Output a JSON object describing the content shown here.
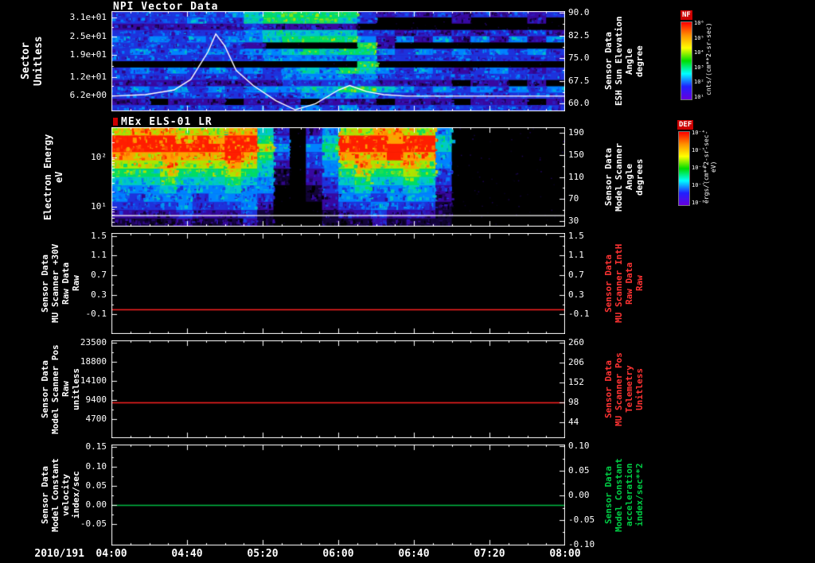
{
  "x_axis": {
    "date_label": "2010/191",
    "tick_labels": [
      "04:00",
      "04:40",
      "05:20",
      "06:00",
      "06:40",
      "07:20",
      "08:00"
    ],
    "range_hours": [
      4,
      8
    ]
  },
  "colorbars": [
    {
      "name": "NF",
      "units": "cnts/(cm**2-sr-sec)",
      "tick_labels": [
        "10⁶",
        "10⁵",
        "10⁴",
        "10³",
        "10²",
        "10¹"
      ],
      "gradient_top_to_bottom": [
        "#ff0000",
        "#ff9000",
        "#ffff00",
        "#00dd00",
        "#00ffff",
        "#2020ff",
        "#6600dd"
      ]
    },
    {
      "name": "DEF",
      "units": "ergs/(cm**2-sr-sec-eV)",
      "tick_labels": [
        "10⁻⁴",
        "10⁻⁵",
        "10⁻⁶",
        "10⁻⁷",
        "10⁻⁸"
      ],
      "gradient_top_to_bottom": [
        "#ff0000",
        "#ff9000",
        "#ffff00",
        "#00dd00",
        "#00ffff",
        "#2020ff",
        "#6600dd"
      ]
    }
  ],
  "chart_data": [
    {
      "type": "heatmap",
      "title": "NPI Vector Data",
      "left_label_lines": [
        "Sector",
        "Unitless"
      ],
      "right_label_lines": [
        "Sensor Data",
        "ESH Sun Elevation",
        "Angle",
        "degree"
      ],
      "right_label_color": "#ffffff",
      "left_axis": {
        "range": [
          1,
          33
        ],
        "ticks": [
          {
            "label": "3.1e+01",
            "value": 31
          },
          {
            "label": "2.5e+01",
            "value": 25
          },
          {
            "label": "1.9e+01",
            "value": 19
          },
          {
            "label": "1.2e+01",
            "value": 12
          },
          {
            "label": "6.2e+00",
            "value": 6.2
          }
        ]
      },
      "right_axis": {
        "range": [
          57.5,
          90.5
        ],
        "ticks": [
          {
            "label": "90.0",
            "value": 90
          },
          {
            "label": "82.5",
            "value": 82.5
          },
          {
            "label": "75.0",
            "value": 75
          },
          {
            "label": "67.5",
            "value": 67.5
          },
          {
            "label": "60.0",
            "value": 60
          }
        ]
      },
      "grid": [
        "333333456666632323232323",
        "333343356666530000200020",
        "222222232222200000000000",
        "333333345555533232323232",
        "434343445666642424242424",
        "333333320000062000000000",
        "343434344565664343434343",
        "333333334444443333333333",
        "000000000000060000000000",
        "343434343454654343234323",
        "333333333444443333333333",
        "222222222333332222022020",
        "343434344455665434343434",
        "333333333344443333333333",
        "220222022202220222022202",
        "333333333343433333333333"
      ],
      "overlay": {
        "kind": "polyline",
        "axis": "right",
        "color": "#ffffff",
        "points": [
          [
            4.0,
            62.5
          ],
          [
            4.3,
            63
          ],
          [
            4.55,
            64.5
          ],
          [
            4.7,
            68
          ],
          [
            4.85,
            77
          ],
          [
            4.92,
            83
          ],
          [
            5.0,
            79
          ],
          [
            5.1,
            71
          ],
          [
            5.25,
            66
          ],
          [
            5.45,
            61
          ],
          [
            5.62,
            58
          ],
          [
            5.8,
            60
          ],
          [
            6.0,
            64.5
          ],
          [
            6.1,
            66
          ],
          [
            6.25,
            64
          ],
          [
            6.4,
            63
          ],
          [
            6.6,
            62.5
          ],
          [
            8.0,
            62.5
          ]
        ]
      }
    },
    {
      "type": "heatmap",
      "title": "MEx ELS-01 LR",
      "left_label_lines": [
        "Electron Energy",
        "eV"
      ],
      "right_label_lines": [
        "Sensor Data",
        "Model Scanner",
        "Angle",
        "degrees"
      ],
      "right_label_color": "#ffffff",
      "left_axis": {
        "scale": "log",
        "range": [
          4,
          400
        ],
        "ticks": [
          {
            "label": "10²",
            "value": 100
          },
          {
            "label": "10¹",
            "value": 10
          }
        ],
        "minor_values": [
          300,
          200,
          90,
          80,
          70,
          60,
          50,
          40,
          30,
          20,
          9,
          8,
          7,
          6,
          5
        ]
      },
      "right_axis": {
        "range": [
          20,
          200
        ],
        "ticks": [
          {
            "label": "190",
            "value": 190
          },
          {
            "label": "150",
            "value": 150
          },
          {
            "label": "110",
            "value": 110
          },
          {
            "label": "70",
            "value": 70
          },
          {
            "label": "30",
            "value": 30
          }
        ]
      },
      "grid": [
        "7888777885202477887740000000",
        "9999898996303599989950000000",
        "9999999997404699999950000000",
        "8888888986303588898840000000",
        "7778777875203478778740000000",
        "6667666765102467667630000000",
        "5556555654102356556530000000",
        "4445444544001345445420000000",
        "4344434443001244344420000000",
        "3333433342000233433310000000",
        "2222322231000122322210000000",
        "1111211121000111211110000000"
      ],
      "overlay": {
        "kind": "hline",
        "axis": "right",
        "color": "#ffffff",
        "value": 40
      }
    },
    {
      "type": "line",
      "series_name": "MU Scanner +30V Raw Data",
      "left_label_lines": [
        "Sensor Data",
        "MU Scanner +30V",
        "Raw Data",
        "Raw"
      ],
      "right_label_lines": [
        "Sensor Data",
        "MU Scanner IntH",
        "Raw Data",
        "Raw"
      ],
      "right_label_color": "#ff3333",
      "line_color": "#ff2222",
      "constant_value": 0.0,
      "left_axis": {
        "range": [
          -0.5,
          1.56
        ],
        "ticks": [
          {
            "label": "1.5",
            "value": 1.5
          },
          {
            "label": "1.1",
            "value": 1.1
          },
          {
            "label": "0.7",
            "value": 0.7
          },
          {
            "label": "0.3",
            "value": 0.3
          },
          {
            "label": "-0.1",
            "value": -0.1
          }
        ]
      },
      "right_axis": {
        "range": [
          -0.5,
          1.56
        ],
        "ticks": [
          {
            "label": "1.5",
            "value": 1.5
          },
          {
            "label": "1.1",
            "value": 1.1
          },
          {
            "label": "0.7",
            "value": 0.7
          },
          {
            "label": "0.3",
            "value": 0.3
          },
          {
            "label": "-0.1",
            "value": -0.1
          }
        ]
      }
    },
    {
      "type": "line",
      "series_name": "Model Scanner Pos Raw",
      "left_label_lines": [
        "Sensor Data",
        "Model Scanner Pos",
        "Raw",
        "unitless"
      ],
      "right_label_lines": [
        "Sensor Data",
        "MU Scanner Pos",
        "Telemetry",
        "Unitless"
      ],
      "right_label_color": "#ff3333",
      "line_color": "#ff2222",
      "constant_value": 8800,
      "left_axis": {
        "range": [
          0,
          24100
        ],
        "ticks": [
          {
            "label": "23500",
            "value": 23500
          },
          {
            "label": "18800",
            "value": 18800
          },
          {
            "label": "14100",
            "value": 14100
          },
          {
            "label": "9400",
            "value": 9400
          },
          {
            "label": "4700",
            "value": 4700
          }
        ]
      },
      "right_axis": {
        "range": [
          0,
          267
        ],
        "ticks": [
          {
            "label": "260",
            "value": 260
          },
          {
            "label": "206",
            "value": 206
          },
          {
            "label": "152",
            "value": 152
          },
          {
            "label": "98",
            "value": 98
          },
          {
            "label": "44",
            "value": 44
          }
        ]
      }
    },
    {
      "type": "line",
      "series_name": "Model Constant velocity",
      "left_label_lines": [
        "Sensor Data",
        "Model Constant",
        "velocity",
        "index/sec"
      ],
      "right_label_lines": [
        "Sensor Data",
        "Model Constant",
        "acceleration",
        "index/sec**2"
      ],
      "right_label_color": "#00cc44",
      "line_color": "#00bb44",
      "constant_value": 0.0,
      "left_axis": {
        "range": [
          -0.105,
          0.157
        ],
        "ticks": [
          {
            "label": "0.15",
            "value": 0.15
          },
          {
            "label": "0.10",
            "value": 0.1
          },
          {
            "label": "0.05",
            "value": 0.05
          },
          {
            "label": "0.00",
            "value": 0.0
          },
          {
            "label": "-0.05",
            "value": -0.05
          }
        ]
      },
      "right_axis": {
        "range": [
          -0.102,
          0.104
        ],
        "ticks": [
          {
            "label": "0.10",
            "value": 0.1
          },
          {
            "label": "0.05",
            "value": 0.05
          },
          {
            "label": "0.00",
            "value": 0.0
          },
          {
            "label": "-0.05",
            "value": -0.05
          },
          {
            "label": "-0.10",
            "value": -0.1
          }
        ]
      }
    }
  ]
}
